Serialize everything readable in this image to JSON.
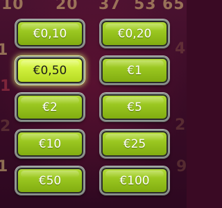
{
  "background_numbers": [
    "10",
    "20",
    "37",
    "53",
    "65",
    "4",
    "1",
    "1",
    "2",
    "1",
    "2",
    "9"
  ],
  "bet_options": [
    {
      "label": "€0,10",
      "selected": false
    },
    {
      "label": "€0,20",
      "selected": false
    },
    {
      "label": "€0,50",
      "selected": true
    },
    {
      "label": "€1",
      "selected": false
    },
    {
      "label": "€2",
      "selected": false
    },
    {
      "label": "€5",
      "selected": false
    },
    {
      "label": "€10",
      "selected": false
    },
    {
      "label": "€25",
      "selected": false
    },
    {
      "label": "€50",
      "selected": false
    },
    {
      "label": "€100",
      "selected": false
    }
  ],
  "colors": {
    "button_green": "#98c51f",
    "button_selected": "#cfef3c",
    "background": "#3b0c27"
  }
}
